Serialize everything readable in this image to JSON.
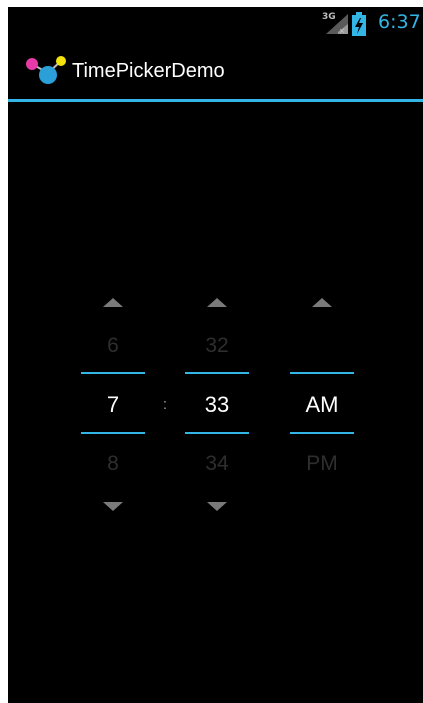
{
  "status_bar": {
    "network_type": "3G",
    "clock": "6:37",
    "signal_icon": "signal-strength-icon",
    "battery_icon": "battery-charging-icon",
    "accent_color": "#33b5e5"
  },
  "action_bar": {
    "title": "TimePickerDemo",
    "icon": "app-molecule-icon"
  },
  "time_picker": {
    "hour": {
      "prev": "6",
      "current": "7",
      "next": "8"
    },
    "separator": ":",
    "minute": {
      "prev": "32",
      "current": "33",
      "next": "34"
    },
    "ampm": {
      "prev": "",
      "current": "AM",
      "next": "PM"
    }
  }
}
